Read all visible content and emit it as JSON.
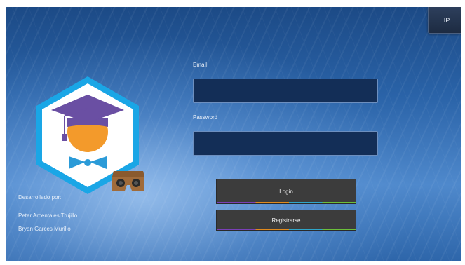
{
  "ip_button": {
    "label": "IP"
  },
  "form": {
    "email": {
      "label": "Email",
      "value": "",
      "placeholder": ""
    },
    "password": {
      "label": "Password",
      "value": "",
      "placeholder": ""
    },
    "login_label": "Login",
    "register_label": "Registrarse"
  },
  "credits": {
    "heading": "Desarrollado por:",
    "authors": [
      "Peter Arcentales Trujillo",
      "Bryan Garces Murillo"
    ]
  },
  "icons": {
    "logo": "graduate-hexagon-logo-icon",
    "vr": "vr-cardboard-icon"
  },
  "colors": {
    "logo_hex_border": "#1aa6e6",
    "mortarboard": "#6a4fa3",
    "face": "#f39a2b",
    "bowtie": "#2b9bd8",
    "button_bg": "#3c3c3c",
    "field_bg": "#132e57"
  }
}
